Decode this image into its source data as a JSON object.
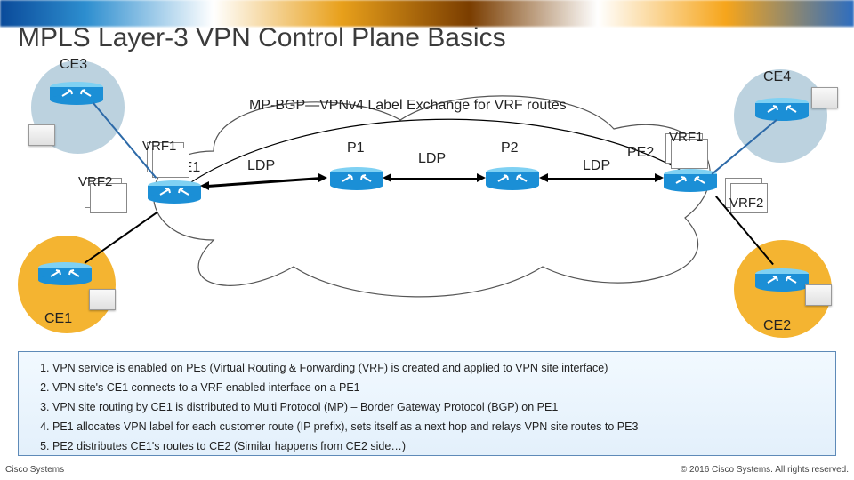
{
  "title": "MPLS Layer-3 VPN Control Plane Basics",
  "mpbgp_caption": "MP-BGP—VPNv4 Label Exchange for VRF routes",
  "labels": {
    "CE1": "CE1",
    "CE2": "CE2",
    "CE3": "CE3",
    "CE4": "CE4",
    "PE1": "PE1",
    "PE2": "PE2",
    "P1": "P1",
    "P2": "P2",
    "VRF1": "VRF1",
    "VRF2": "VRF2",
    "LDP": "LDP"
  },
  "colors": {
    "ce_orange_bg": "#f4b431",
    "ce_blue_bg": "#bcd2df",
    "router_body": "#1b8fd6",
    "router_top": "#7fd1f3"
  },
  "notes": [
    "VPN service is enabled on PEs (Virtual Routing & Forwarding (VRF) is created and applied to VPN site interface)",
    "VPN site's CE1 connects to a VRF enabled interface on a PE1",
    "VPN site routing by CE1  is distributed to Multi Protocol (MP) – Border Gateway Protocol (BGP) on PE1",
    "PE1 allocates VPN label for each customer route (IP prefix), sets itself as a next hop and relays VPN site routes to PE3",
    "PE2 distributes CE1's routes to CE2 (Similar happens from CE2 side…)"
  ],
  "footer": {
    "left": "Cisco Systems",
    "right": "© 2016 Cisco Systems. All rights reserved."
  }
}
